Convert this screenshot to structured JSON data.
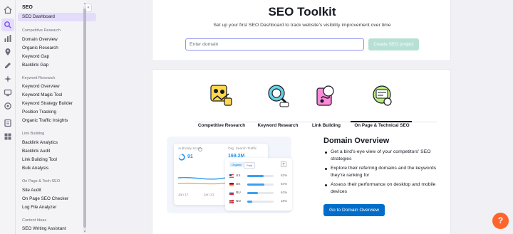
{
  "rail": {
    "icons": [
      "home-icon",
      "seo-icon",
      "local-icon",
      "location-icon",
      "content-icon",
      "ai-icon",
      "ads-icon",
      "social-icon",
      "reports-icon",
      "apps-icon"
    ]
  },
  "sidebar": {
    "heading": "SEO",
    "collapse_glyph": "«",
    "dashboard": "SEO Dashboard",
    "groups": [
      {
        "title": "Competitive Research",
        "items": [
          "Domain Overview",
          "Organic Research",
          "Keyword Gap",
          "Backlink Gap"
        ]
      },
      {
        "title": "Keyword Research",
        "items": [
          "Keyword Overview",
          "Keyword Magic Tool",
          "Keyword Strategy Builder",
          "Position Tracking",
          "Organic Traffic Insights"
        ]
      },
      {
        "title": "Link Building",
        "items": [
          "Backlink Analytics",
          "Backlink Audit",
          "Link Building Tool",
          "Bulk Analysis"
        ]
      },
      {
        "title": "On Page & Tech SEO",
        "items": [
          "Site Audit",
          "On Page SEO Checker",
          "Log File Analyzer"
        ]
      },
      {
        "title": "Content Ideas",
        "items": [
          "SEO Writing Assistant"
        ]
      }
    ]
  },
  "header": {
    "title": "SEO Toolkit",
    "subtitle": "Set up your first SEO Dashboard to track website’s visibility improvement over time",
    "input_placeholder": "Enter domain",
    "create_button": "Create SEO project"
  },
  "tabs": [
    {
      "label": "Competitive Research"
    },
    {
      "label": "Keyword Research"
    },
    {
      "label": "Link Building"
    },
    {
      "label": "On Page & Technical SEO"
    }
  ],
  "preview": {
    "authority_label": "Authority Score",
    "authority_value": "91",
    "traffic_label": "Org. Search Traffic",
    "traffic_value": "169.2M",
    "dates": [
      "Jan 17",
      "Jan 21"
    ],
    "toggle": [
      "Organic",
      "Paid"
    ],
    "databases": [
      {
        "code": "US",
        "pct": "62%",
        "value": 0.62
      },
      {
        "code": "UK",
        "pct": "64%",
        "value": 0.64
      },
      {
        "code": "RU",
        "pct": "40%",
        "value": 0.4
      },
      {
        "code": "NO",
        "pct": "18%",
        "value": 0.18
      }
    ]
  },
  "overview": {
    "title": "Domain Overview",
    "bullets": [
      "Get a bird’s-eye view of your competitors’ SEO strategies",
      "Explore their referring domains and the keywords they’re ranking for",
      "Assess their performance on desktop and mobile devices"
    ],
    "button": "Go to Domain Overview"
  },
  "help": {
    "label": "?"
  },
  "colors": {
    "accent": "#006dca",
    "help": "#ff642d",
    "active_bg": "#e4dcfb",
    "bar": "#3aa0f0"
  }
}
